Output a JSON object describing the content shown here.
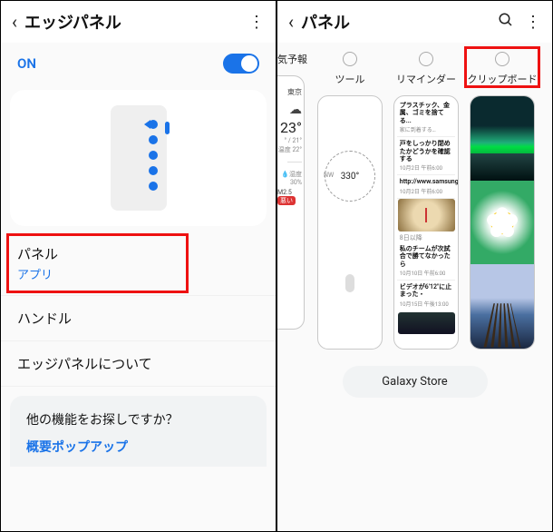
{
  "left": {
    "title": "エッジパネル",
    "toggle_label": "ON",
    "menu": {
      "panel": {
        "title": "パネル",
        "sub": "アプリ"
      },
      "handle": {
        "title": "ハンドル"
      },
      "about": {
        "title": "エッジパネルについて"
      }
    },
    "footer": {
      "title": "他の機能をお探しですか？",
      "link": "概要ポップアップ"
    }
  },
  "right": {
    "title": "パネル",
    "panels": {
      "weather": {
        "label": "気予報",
        "city": "東京",
        "temp": "23°",
        "range": "° / 21°",
        "feels": "温度 22°",
        "humidity_label": "湿度",
        "humidity": "30%",
        "pm_label": "M2.5",
        "pm_badge": "悪い"
      },
      "tools": {
        "label": "ツール",
        "compass_dir": "NW",
        "compass_deg": "330°"
      },
      "reminder": {
        "label": "リマインダー",
        "items": [
          {
            "t": "プラスチック、金属、ゴミを捨てる...",
            "d": "家に到着する…"
          },
          {
            "t": "戸をしっかり閉めたかどうかを確認する",
            "d": "10月2日 午前6:00"
          },
          {
            "t_link": "http://www.samsung.com",
            "d": "10月2日 午前6:00"
          },
          {
            "prev": "8日以降"
          },
          {
            "t": "私のチームが次試合で勝てなかったら",
            "d": "10月10日 午前6:00"
          },
          {
            "t": "ビデオが6'12\"に止まった・",
            "d": "10月15日 午後13:00"
          }
        ]
      },
      "clipboard": {
        "label": "クリップボード"
      }
    },
    "store_button": "Galaxy Store"
  }
}
